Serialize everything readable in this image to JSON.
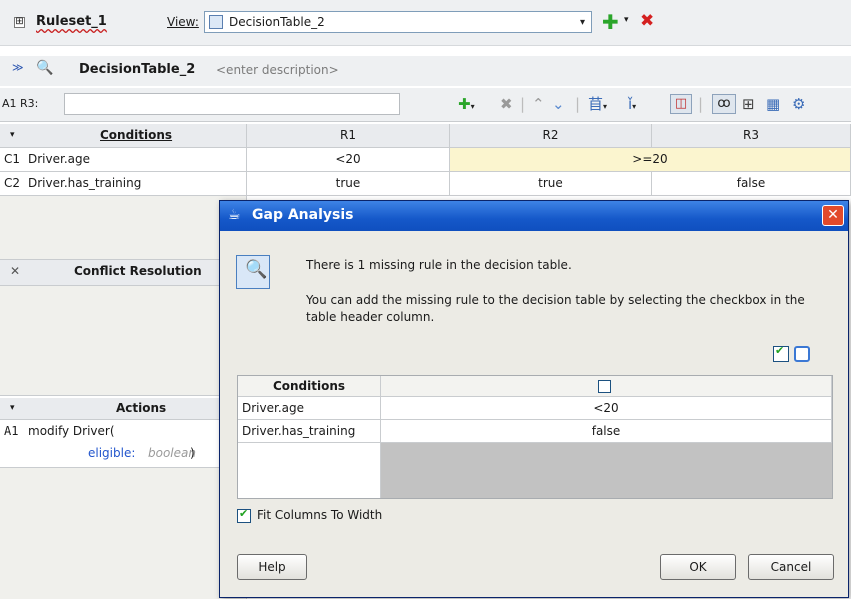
{
  "ruleset": {
    "expand": "⊞",
    "name": "Ruleset_1",
    "view_label": "View:",
    "view_value": "DecisionTable_2",
    "dropdown_arrow": "▾",
    "add_icon": "✚",
    "delete_icon": "✖"
  },
  "decision_table": {
    "name": "DecisionTable_2",
    "description_placeholder": "<enter description>"
  },
  "cell_ref": {
    "label": "A1 R3:",
    "value": ""
  },
  "toolbar": {
    "icons": [
      "add-icon",
      "delete-icon",
      "move-up-icon",
      "move-down-icon",
      "insert-column-icon",
      "split-icon",
      "gap-analysis-icon",
      "glasses-icon",
      "compact-icon",
      "table-icon",
      "more-icon"
    ]
  },
  "grid": {
    "conditions_header": "Conditions",
    "rule_headers": [
      "R1",
      "R2",
      "R3"
    ],
    "conditions": [
      {
        "id": "C1",
        "name": "Driver.age",
        "values": [
          "<20",
          ">=20"
        ]
      },
      {
        "id": "C2",
        "name": "Driver.has_training",
        "values": [
          "true",
          "true",
          "false"
        ]
      }
    ],
    "conflict_header": "Conflict Resolution",
    "actions_header": "Actions",
    "actions": [
      {
        "id": "A1",
        "text": "modify Driver(",
        "param_name": "eligible:",
        "param_type": "boolean",
        "close": ")"
      }
    ]
  },
  "dialog": {
    "title": "Gap Analysis",
    "message1": "There is 1 missing rule in the decision table.",
    "message2": "You can add the missing rule to the decision table by selecting the checkbox in the table header column.",
    "table": {
      "header": "Conditions",
      "rows": [
        {
          "name": "Driver.age",
          "value": "<20"
        },
        {
          "name": "Driver.has_training",
          "value": "false"
        }
      ]
    },
    "fit_columns_label": "Fit Columns To Width",
    "fit_columns_checked": true,
    "help": "Help",
    "ok": "OK",
    "cancel": "Cancel",
    "close": "✕"
  }
}
